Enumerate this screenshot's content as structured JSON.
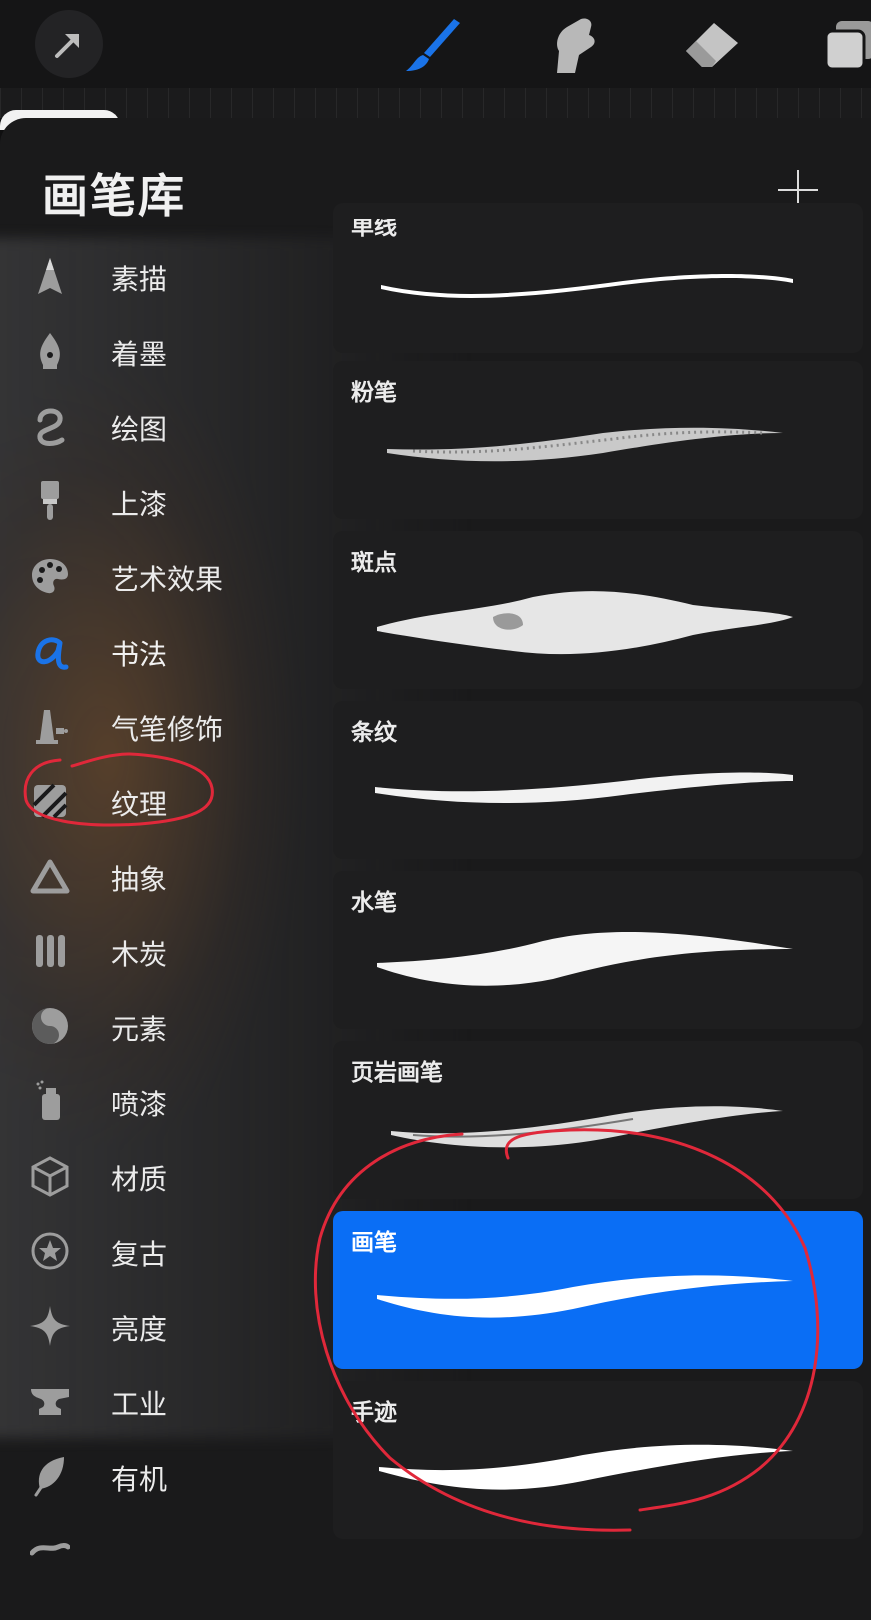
{
  "toolbar": {
    "tools": [
      {
        "name": "modify-tool",
        "icon": "arrow-icon"
      },
      {
        "name": "brush-tool",
        "icon": "paintbrush-icon",
        "active": true,
        "color": "#1a73e8"
      },
      {
        "name": "smudge-tool",
        "icon": "smudge-finger-icon"
      },
      {
        "name": "eraser-tool",
        "icon": "eraser-icon"
      },
      {
        "name": "layers-tool",
        "icon": "layers-icon"
      }
    ]
  },
  "panel": {
    "title": "画笔库",
    "add_icon": "plus-icon"
  },
  "categories": [
    {
      "label": "素描",
      "icon": "pencil-tip-icon"
    },
    {
      "label": "着墨",
      "icon": "pen-nib-icon"
    },
    {
      "label": "绘图",
      "icon": "squiggle-icon"
    },
    {
      "label": "上漆",
      "icon": "paint-brush-icon"
    },
    {
      "label": "艺术效果",
      "icon": "palette-icon"
    },
    {
      "label": "书法",
      "icon": "calligraphy-a-icon",
      "active": true
    },
    {
      "label": "气笔修饰",
      "icon": "airbrush-icon"
    },
    {
      "label": "纹理",
      "icon": "texture-hatch-icon"
    },
    {
      "label": "抽象",
      "icon": "triangle-icon"
    },
    {
      "label": "木炭",
      "icon": "charcoal-sticks-icon"
    },
    {
      "label": "元素",
      "icon": "yin-yang-icon"
    },
    {
      "label": "喷漆",
      "icon": "spray-can-icon"
    },
    {
      "label": "材质",
      "icon": "cube-icon"
    },
    {
      "label": "复古",
      "icon": "star-circle-icon"
    },
    {
      "label": "亮度",
      "icon": "sparkle-icon"
    },
    {
      "label": "工业",
      "icon": "anvil-icon"
    },
    {
      "label": "有机",
      "icon": "leaf-icon"
    }
  ],
  "brushes": [
    {
      "name": "单线",
      "style": "monoline"
    },
    {
      "name": "粉笔",
      "style": "chalk"
    },
    {
      "name": "斑点",
      "style": "blotchy"
    },
    {
      "name": "条纹",
      "style": "streaks"
    },
    {
      "name": "水笔",
      "style": "waterpen"
    },
    {
      "name": "页岩画笔",
      "style": "shale"
    },
    {
      "name": "画笔",
      "style": "brush",
      "selected": true
    },
    {
      "name": "手迹",
      "style": "script"
    }
  ],
  "colors": {
    "accent": "#0a6ef5",
    "annotation": "#e0283a",
    "panel_bg": "#1a1a1b"
  }
}
